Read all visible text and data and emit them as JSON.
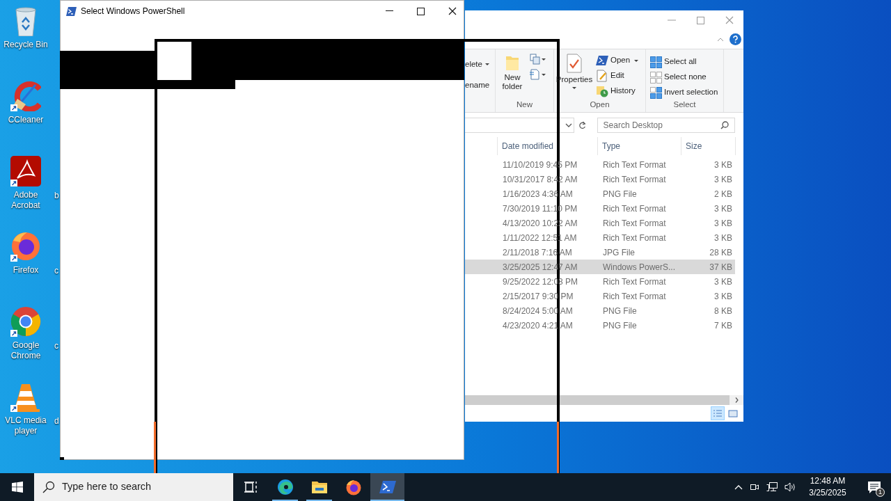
{
  "desktop_icons": [
    {
      "label": "Recycle Bin",
      "kind": "recycle",
      "shortcut": false
    },
    {
      "label": "CCleaner",
      "kind": "ccleaner",
      "shortcut": true
    },
    {
      "label": "Adobe Acrobat",
      "kind": "acrobat",
      "shortcut": true
    },
    {
      "label": "Firefox",
      "kind": "firefox",
      "shortcut": true
    },
    {
      "label": "Google Chrome",
      "kind": "chrome",
      "shortcut": true
    },
    {
      "label": "VLC media player",
      "kind": "vlc",
      "shortcut": true
    }
  ],
  "desktop_partial_labels": [
    "b",
    "c",
    "c",
    "d"
  ],
  "powershell_window": {
    "title": "Select Windows PowerShell"
  },
  "explorer": {
    "ribbon": {
      "clipped": [
        "elete",
        "ename"
      ],
      "new_group": {
        "new_folder": "New folder",
        "label": "New"
      },
      "open_group": {
        "properties": "Properties",
        "open": "Open",
        "edit": "Edit",
        "history": "History",
        "label": "Open"
      },
      "select_group": {
        "select_all": "Select all",
        "select_none": "Select none",
        "invert": "Invert selection",
        "label": "Select"
      }
    },
    "search": {
      "placeholder": "Search Desktop"
    },
    "columns": [
      "Date modified",
      "Type",
      "Size"
    ],
    "rows": [
      {
        "date_modified": "11/10/2019 9:45 PM",
        "type": "Rich Text Format",
        "size": "3 KB",
        "selected": false
      },
      {
        "date_modified": "10/31/2017 8:42 AM",
        "type": "Rich Text Format",
        "size": "3 KB",
        "selected": false
      },
      {
        "date_modified": "1/16/2023 4:36 AM",
        "type": "PNG File",
        "size": "2 KB",
        "selected": false
      },
      {
        "date_modified": "7/30/2019 11:10 PM",
        "type": "Rich Text Format",
        "size": "3 KB",
        "selected": false
      },
      {
        "date_modified": "4/13/2020 10:22 AM",
        "type": "Rich Text Format",
        "size": "3 KB",
        "selected": false
      },
      {
        "date_modified": "1/11/2022 12:51 AM",
        "type": "Rich Text Format",
        "size": "3 KB",
        "selected": false
      },
      {
        "date_modified": "2/11/2018 7:16 AM",
        "type": "JPG File",
        "size": "28 KB",
        "selected": false
      },
      {
        "date_modified": "3/25/2025 12:47 AM",
        "type": "Windows PowerS...",
        "size": "37 KB",
        "selected": true
      },
      {
        "date_modified": "9/25/2022 12:03 PM",
        "type": "Rich Text Format",
        "size": "3 KB",
        "selected": false
      },
      {
        "date_modified": "2/15/2017 9:30 PM",
        "type": "Rich Text Format",
        "size": "3 KB",
        "selected": false
      },
      {
        "date_modified": "8/24/2024 5:00 AM",
        "type": "PNG File",
        "size": "8 KB",
        "selected": false
      },
      {
        "date_modified": "4/23/2020 4:21 AM",
        "type": "PNG File",
        "size": "7 KB",
        "selected": false
      }
    ],
    "views": [
      {
        "kind": "details",
        "selected": true
      },
      {
        "kind": "large",
        "selected": false
      }
    ]
  },
  "taskbar": {
    "search": {
      "placeholder": "Type here to search"
    },
    "apps": [
      {
        "kind": "taskview",
        "running": false,
        "selected": false
      },
      {
        "kind": "edge",
        "running": true,
        "selected": false
      },
      {
        "kind": "explorer",
        "running": true,
        "selected": false
      },
      {
        "kind": "firefox",
        "running": false,
        "selected": false
      },
      {
        "kind": "powershell",
        "running": true,
        "selected": true
      }
    ],
    "clock": {
      "time": "12:48 AM",
      "date": "3/25/2025"
    },
    "notifications": "1"
  }
}
